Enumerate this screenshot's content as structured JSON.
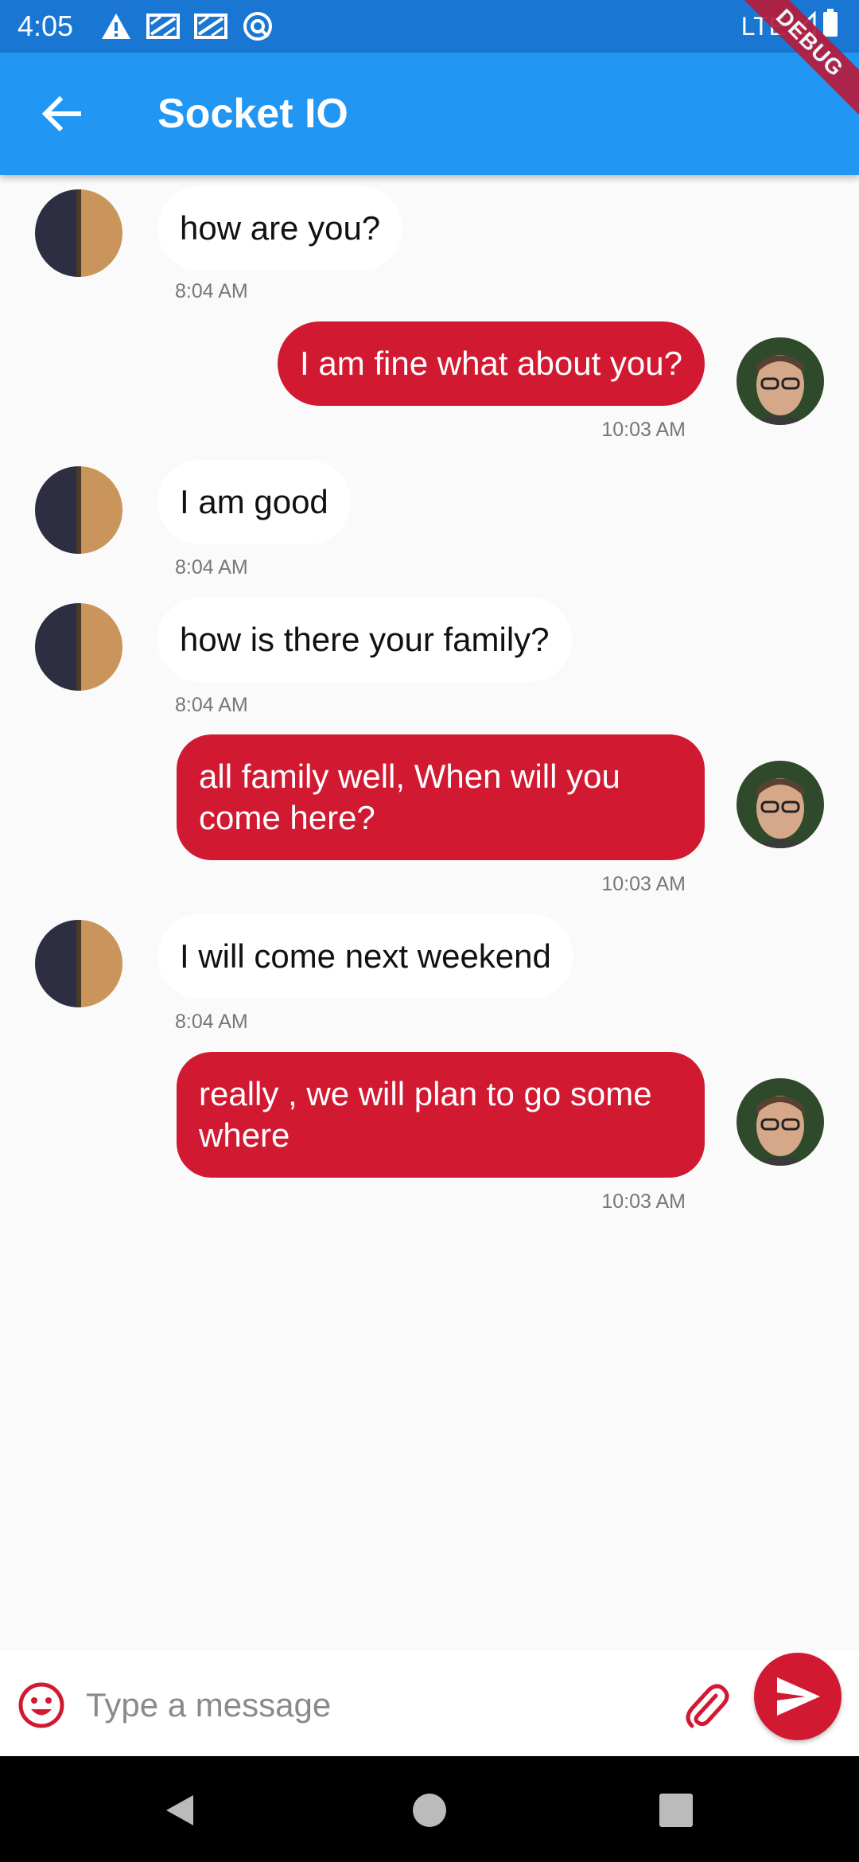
{
  "status_bar": {
    "time": "4:05",
    "network": "LTE",
    "icons_left": [
      "warning-icon",
      "no-sim-icon",
      "no-sim-icon",
      "data-saver-icon"
    ],
    "debug_label": "DEBUG"
  },
  "app_bar": {
    "title": "Socket IO",
    "back_icon": "arrow-back-icon"
  },
  "messages": [
    {
      "direction": "incoming",
      "text": "how are you?",
      "time": "8:04 AM"
    },
    {
      "direction": "outgoing",
      "text": "I am fine what about you?",
      "time": "10:03 AM"
    },
    {
      "direction": "incoming",
      "text": "I am good",
      "time": "8:04 AM"
    },
    {
      "direction": "incoming",
      "text": "how is there your family?",
      "time": "8:04 AM"
    },
    {
      "direction": "outgoing",
      "text": "all family well, When will you come here?",
      "time": "10:03 AM"
    },
    {
      "direction": "incoming",
      "text": "I will come next weekend",
      "time": "8:04 AM"
    },
    {
      "direction": "outgoing",
      "text": "really , we will plan to go some where",
      "time": "10:03 AM"
    }
  ],
  "input": {
    "placeholder": "Type a message",
    "value": ""
  },
  "colors": {
    "app_bar": "#2196f3",
    "status_bar": "#1976d2",
    "accent": "#d11a32",
    "background": "#fafafa"
  }
}
